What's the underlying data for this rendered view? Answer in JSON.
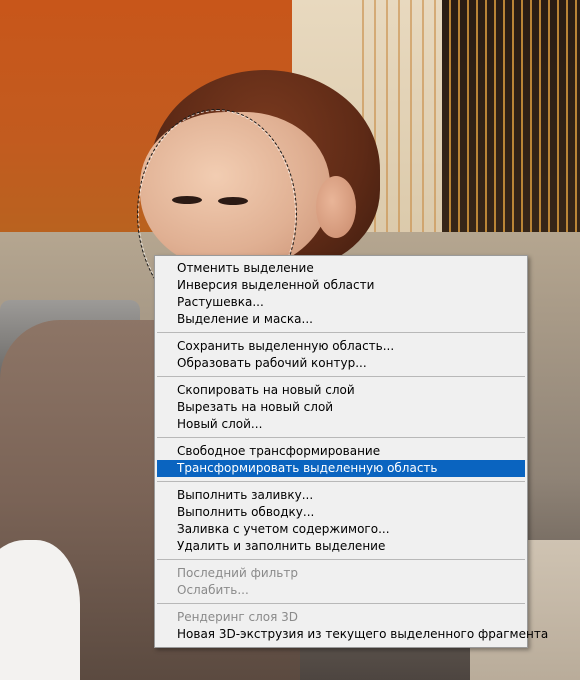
{
  "context_menu": {
    "groups": [
      {
        "items": [
          {
            "label": "Отменить выделение",
            "enabled": true
          },
          {
            "label": "Инверсия выделенной области",
            "enabled": true
          },
          {
            "label": "Растушевка...",
            "enabled": true
          },
          {
            "label": "Выделение и маска...",
            "enabled": true
          }
        ]
      },
      {
        "items": [
          {
            "label": "Сохранить выделенную область...",
            "enabled": true
          },
          {
            "label": "Образовать рабочий контур...",
            "enabled": true
          }
        ]
      },
      {
        "items": [
          {
            "label": "Скопировать на новый слой",
            "enabled": true
          },
          {
            "label": "Вырезать на новый слой",
            "enabled": true
          },
          {
            "label": "Новый слой...",
            "enabled": true
          }
        ]
      },
      {
        "items": [
          {
            "label": "Свободное трансформирование",
            "enabled": true
          },
          {
            "label": "Трансформировать выделенную область",
            "enabled": true,
            "highlighted": true
          }
        ]
      },
      {
        "items": [
          {
            "label": "Выполнить заливку...",
            "enabled": true
          },
          {
            "label": "Выполнить обводку...",
            "enabled": true
          },
          {
            "label": "Заливка с учетом содержимого...",
            "enabled": true
          },
          {
            "label": "Удалить и заполнить выделение",
            "enabled": true
          }
        ]
      },
      {
        "items": [
          {
            "label": "Последний фильтр",
            "enabled": false
          },
          {
            "label": "Ослабить...",
            "enabled": false
          }
        ]
      },
      {
        "items": [
          {
            "label": "Рендеринг слоя 3D",
            "enabled": false
          },
          {
            "label": "Новая 3D-экструзия из текущего выделенного фрагмента",
            "enabled": true
          }
        ]
      }
    ]
  },
  "colors": {
    "menu_bg": "#f0f0f0",
    "highlight": "#0a64c0",
    "disabled_text": "#8a8a8a"
  }
}
